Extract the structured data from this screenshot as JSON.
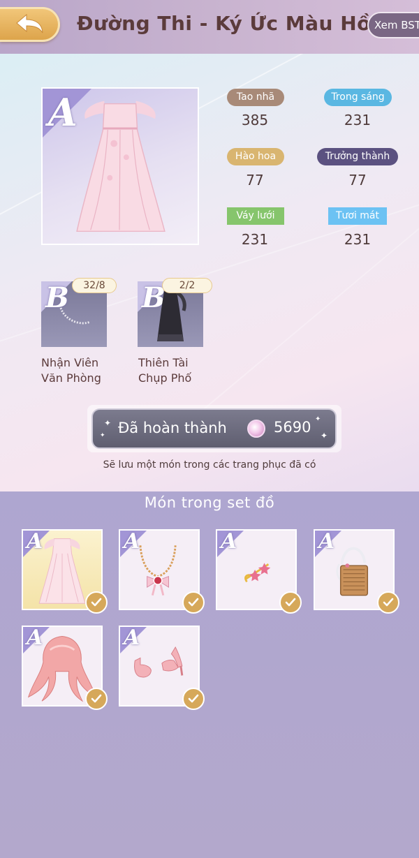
{
  "header": {
    "title": "Đường Thi - Ký Ức Màu Hồng",
    "collection_button": "Xem BST"
  },
  "main_item": {
    "grade": "A",
    "icon": "pink-gown-icon"
  },
  "attributes": [
    {
      "label": "Tao nhã",
      "value": "385",
      "color": "#a88a78"
    },
    {
      "label": "Trong sáng",
      "value": "231",
      "color": "#5ab7e2"
    },
    {
      "label": "Hào hoa",
      "value": "77",
      "color": "#d9b570"
    },
    {
      "label": "Trưởng thành",
      "value": "77",
      "color": "#5b5180"
    },
    {
      "label": "Váy lưới",
      "value": "231",
      "color": "#86c56c"
    },
    {
      "label": "Tươi mát",
      "value": "231",
      "color": "#6cc2f3"
    }
  ],
  "related_items": [
    {
      "grade": "B",
      "count": "32/8",
      "name": "Nhận Viên Văn Phòng",
      "icon": "pearl-necklace-icon"
    },
    {
      "grade": "B",
      "count": "2/2",
      "name": "Thiên Tài Chụp Phố",
      "icon": "black-dress-icon"
    }
  ],
  "complete_button": {
    "label": "Đã hoàn thành",
    "currency_icon": "pearl-icon",
    "amount": "5690"
  },
  "note": "Sẽ lưu một món trong các trang phục đã có",
  "set_section": {
    "title": "Món trong set đồ",
    "items": [
      {
        "grade": "A",
        "icon": "pink-gown-icon",
        "selected": true
      },
      {
        "grade": "A",
        "icon": "bow-necklace-icon",
        "selected": false
      },
      {
        "grade": "A",
        "icon": "star-hairpin-icon",
        "selected": false
      },
      {
        "grade": "A",
        "icon": "woven-bag-icon",
        "selected": false
      },
      {
        "grade": "A",
        "icon": "pink-wavy-hair-icon",
        "selected": false
      },
      {
        "grade": "A",
        "icon": "pink-heels-icon",
        "selected": false
      }
    ]
  }
}
